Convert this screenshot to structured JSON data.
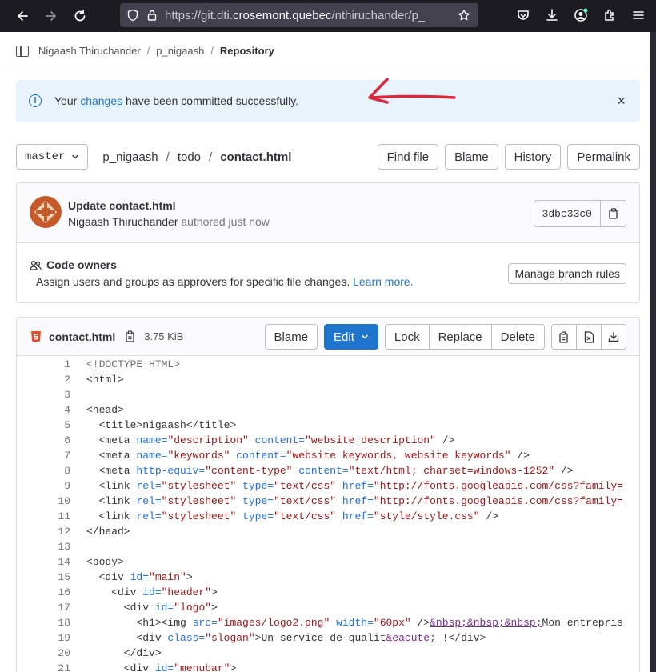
{
  "browser": {
    "url_prefix": "https://git.dti.",
    "url_domain": "crosemont.quebec",
    "url_suffix": "/nthiruchander/p_"
  },
  "breadcrumb": {
    "user": "Nigaash Thiruchander",
    "project": "p_nigaash",
    "current": "Repository"
  },
  "alert": {
    "prefix": "Your ",
    "link": "changes",
    "suffix": " have been committed successfully.",
    "close": "×"
  },
  "repo": {
    "branch": "master",
    "path": [
      "p_nigaash",
      "todo",
      "contact.html"
    ],
    "actions": [
      "Find file",
      "Blame",
      "History",
      "Permalink"
    ]
  },
  "commit": {
    "title": "Update contact.html",
    "author": "Nigaash Thiruchander",
    "meta": "authored just now",
    "sha": "3dbc33c0"
  },
  "code_owners": {
    "title": "Code owners",
    "description": "Assign users and groups as approvers for specific file changes.",
    "learn_more": "Learn more.",
    "manage_button": "Manage branch rules"
  },
  "file": {
    "name": "contact.html",
    "size": "3.75 KiB",
    "blame": "Blame",
    "edit": "Edit",
    "group": [
      "Lock",
      "Replace",
      "Delete"
    ]
  },
  "code_lines": [
    [
      {
        "t": "<!DOCTYPE HTML>",
        "c": "comment"
      }
    ],
    [
      {
        "t": "<html>",
        "c": "tag"
      }
    ],
    [],
    [
      {
        "t": "<head>",
        "c": "tag"
      }
    ],
    [
      {
        "t": "  <title>nigaash</title>",
        "c": "tag"
      }
    ],
    [
      {
        "t": "  <meta ",
        "c": "tag"
      },
      {
        "t": "name=",
        "c": "attr"
      },
      {
        "t": "\"description\"",
        "c": "str"
      },
      {
        "t": " content=",
        "c": "attr"
      },
      {
        "t": "\"website description\"",
        "c": "str"
      },
      {
        "t": " />",
        "c": "tag"
      }
    ],
    [
      {
        "t": "  <meta ",
        "c": "tag"
      },
      {
        "t": "name=",
        "c": "attr"
      },
      {
        "t": "\"keywords\"",
        "c": "str"
      },
      {
        "t": " content=",
        "c": "attr"
      },
      {
        "t": "\"website keywords, website keywords\"",
        "c": "str"
      },
      {
        "t": " />",
        "c": "tag"
      }
    ],
    [
      {
        "t": "  <meta ",
        "c": "tag"
      },
      {
        "t": "http-equiv=",
        "c": "attr"
      },
      {
        "t": "\"content-type\"",
        "c": "str"
      },
      {
        "t": " content=",
        "c": "attr"
      },
      {
        "t": "\"text/html; charset=windows-1252\"",
        "c": "str"
      },
      {
        "t": " />",
        "c": "tag"
      }
    ],
    [
      {
        "t": "  <link ",
        "c": "tag"
      },
      {
        "t": "rel=",
        "c": "attr"
      },
      {
        "t": "\"stylesheet\"",
        "c": "str"
      },
      {
        "t": " type=",
        "c": "attr"
      },
      {
        "t": "\"text/css\"",
        "c": "str"
      },
      {
        "t": " href=",
        "c": "attr"
      },
      {
        "t": "\"http://fonts.googleapis.com/css?family=",
        "c": "str"
      }
    ],
    [
      {
        "t": "  <link ",
        "c": "tag"
      },
      {
        "t": "rel=",
        "c": "attr"
      },
      {
        "t": "\"stylesheet\"",
        "c": "str"
      },
      {
        "t": " type=",
        "c": "attr"
      },
      {
        "t": "\"text/css\"",
        "c": "str"
      },
      {
        "t": " href=",
        "c": "attr"
      },
      {
        "t": "\"http://fonts.googleapis.com/css?family=",
        "c": "str"
      }
    ],
    [
      {
        "t": "  <link ",
        "c": "tag"
      },
      {
        "t": "rel=",
        "c": "attr"
      },
      {
        "t": "\"stylesheet\"",
        "c": "str"
      },
      {
        "t": " type=",
        "c": "attr"
      },
      {
        "t": "\"text/css\"",
        "c": "str"
      },
      {
        "t": " href=",
        "c": "attr"
      },
      {
        "t": "\"style/style.css\"",
        "c": "str"
      },
      {
        "t": " />",
        "c": "tag"
      }
    ],
    [
      {
        "t": "</head>",
        "c": "tag"
      }
    ],
    [],
    [
      {
        "t": "<body>",
        "c": "tag"
      }
    ],
    [
      {
        "t": "  <div ",
        "c": "tag"
      },
      {
        "t": "id=",
        "c": "attr"
      },
      {
        "t": "\"main\"",
        "c": "str"
      },
      {
        "t": ">",
        "c": "tag"
      }
    ],
    [
      {
        "t": "    <div ",
        "c": "tag"
      },
      {
        "t": "id=",
        "c": "attr"
      },
      {
        "t": "\"header\"",
        "c": "str"
      },
      {
        "t": ">",
        "c": "tag"
      }
    ],
    [
      {
        "t": "      <div ",
        "c": "tag"
      },
      {
        "t": "id=",
        "c": "attr"
      },
      {
        "t": "\"logo\"",
        "c": "str"
      },
      {
        "t": ">",
        "c": "tag"
      }
    ],
    [
      {
        "t": "        <h1><img ",
        "c": "tag"
      },
      {
        "t": "src=",
        "c": "attr"
      },
      {
        "t": "\"images/logo2.png\"",
        "c": "str"
      },
      {
        "t": " width=",
        "c": "attr"
      },
      {
        "t": "\"60px\"",
        "c": "str"
      },
      {
        "t": " />",
        "c": "tag"
      },
      {
        "t": "&nbsp;&nbsp;&nbsp;",
        "c": "ent"
      },
      {
        "t": "Mon entrepris",
        "c": "tag"
      }
    ],
    [
      {
        "t": "        <div ",
        "c": "tag"
      },
      {
        "t": "class=",
        "c": "attr"
      },
      {
        "t": "\"slogan\"",
        "c": "str"
      },
      {
        "t": ">Un service de qualit",
        "c": "tag"
      },
      {
        "t": "&eacute;",
        "c": "ent"
      },
      {
        "t": " !</div>",
        "c": "tag"
      }
    ],
    [
      {
        "t": "      </div>",
        "c": "tag"
      }
    ],
    [
      {
        "t": "      <div ",
        "c": "tag"
      },
      {
        "t": "id=",
        "c": "attr"
      },
      {
        "t": "\"menubar\"",
        "c": "str"
      },
      {
        "t": ">",
        "c": "tag"
      }
    ]
  ],
  "colors": {
    "primary": "#1f75cb",
    "alert_bg": "#e9f3fc",
    "annotation": "#d8283a"
  }
}
